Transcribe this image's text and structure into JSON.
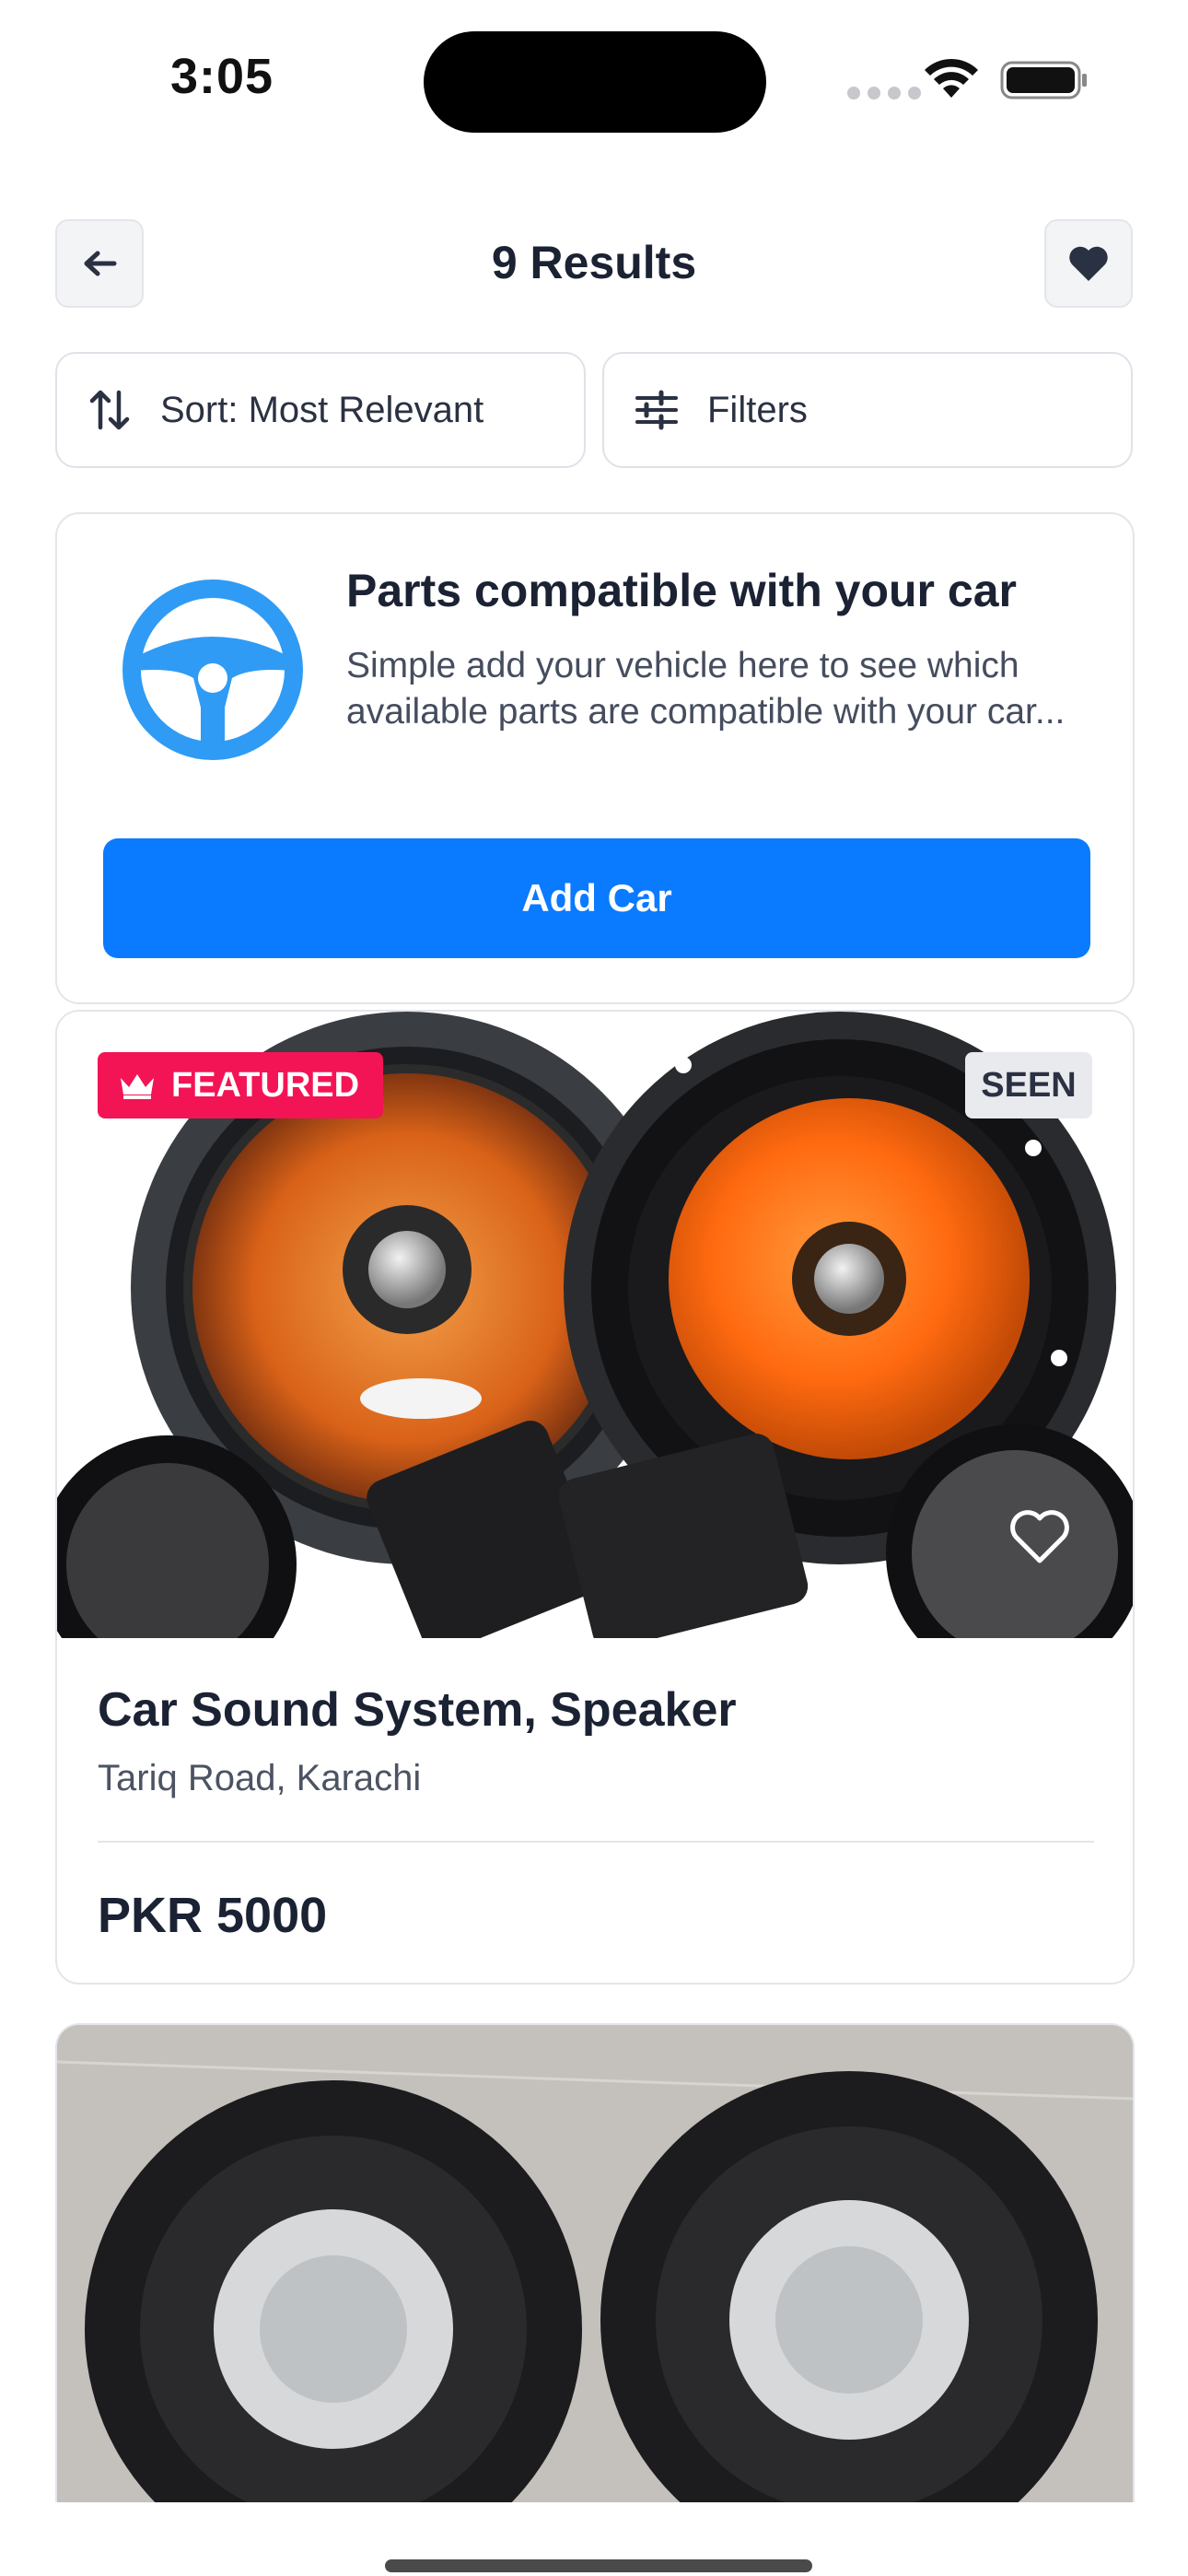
{
  "status_bar": {
    "time": "3:05"
  },
  "header": {
    "title": "9 Results"
  },
  "toolbar": {
    "sort_label": "Sort: Most Relevant",
    "filters_label": "Filters"
  },
  "compat_card": {
    "title": "Parts compatible with your car",
    "description": "Simple add your vehicle here to see which available parts are compatible with your car...",
    "button_label": "Add Car"
  },
  "listings": [
    {
      "badge": "FEATURED",
      "seen_label": "SEEN",
      "title": "Car Sound System, Speaker",
      "location": "Tariq Road, Karachi",
      "price": "PKR 5000"
    }
  ],
  "colors": {
    "accent": "#0a7aff",
    "featured": "#f31455",
    "wheel": "#2f9bf5"
  },
  "icons": [
    "back-arrow-icon",
    "heart-icon",
    "sort-icon",
    "filter-sliders-icon",
    "steering-wheel-icon",
    "crown-icon",
    "wifi-icon",
    "battery-icon"
  ]
}
